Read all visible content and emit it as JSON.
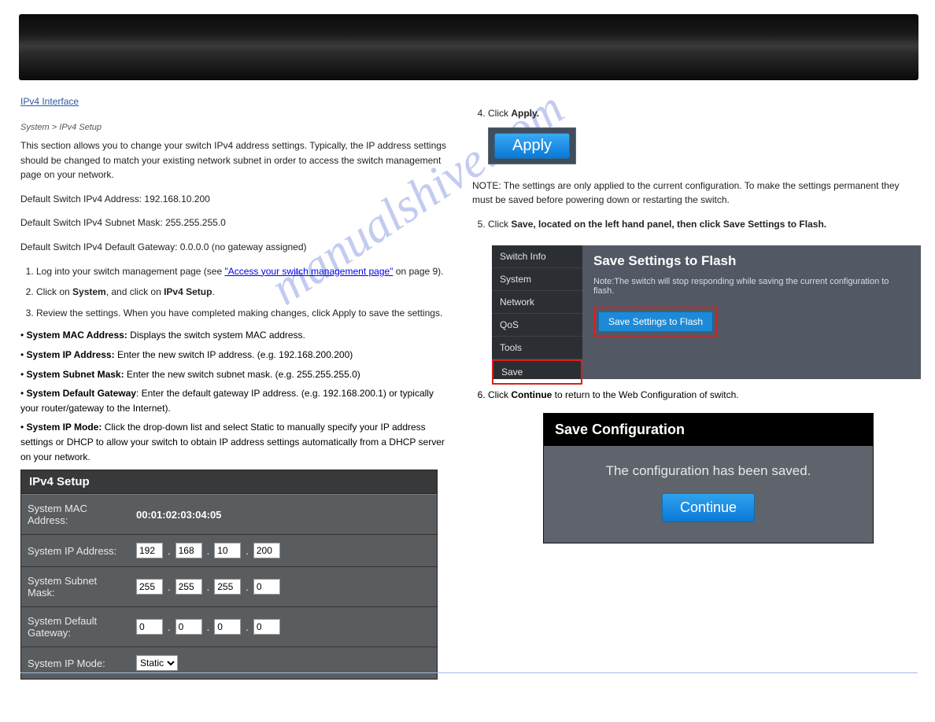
{
  "left": {
    "heading": "IPv4 Interface",
    "link": "System > IPv4 Setup",
    "para1_a": "This section allows you to change your switch IPv4 address settings. Typically, the IP address settings should be changed to match your existing network subnet in order to access the switch management page on your network.",
    "para2": "Default Switch IPv4 Address: 192.168.10.200",
    "para3": "Default Switch IPv4 Subnet Mask: 255.255.255.0",
    "para4": "Default Switch IPv4 Default Gateway: 0.0.0.0 (no gateway assigned)",
    "li1_a": "Log into your switch management page (see ",
    "li1_link": "\"Access your switch management page\"",
    "li1_b": " on page 9).",
    "li2_a": "Click on ",
    "li2_b": "System",
    "li2_c": ", and click on ",
    "li2_d": "IPv4 Setup",
    "li2_e": ".",
    "li3": "Review the settings. When you have completed making changes, click Apply to save the settings.",
    "bullets": {
      "mac_label": "System MAC Address:",
      "mac_text": " Displays the switch system MAC address.",
      "ip_label": "System IP Address:",
      "ip_text": " Enter the new switch IP address. (e.g. 192.168.200.200)",
      "subnet_label": "System Subnet Mask:",
      "subnet_text": " Enter the new switch subnet mask. (e.g. 255.255.255.0)",
      "gw_label": "System Default Gateway",
      "gw_text": ": Enter the default gateway IP address. (e.g. 192.168.200.1) or typically your router/gateway to the Internet).",
      "mode_label": "System IP Mode:",
      "mode_text": " Click the drop-down list and select Static to manually specify your IP address settings or DHCP to allow your switch to obtain IP address settings automatically from a DHCP server on your network."
    }
  },
  "ipv4_panel": {
    "title": "IPv4 Setup",
    "mac_label": "System MAC Address:",
    "mac_value": "00:01:02:03:04:05",
    "ip_label": "System IP Address:",
    "ip": [
      "192",
      "168",
      "10",
      "200"
    ],
    "subnet_label": "System Subnet Mask:",
    "subnet": [
      "255",
      "255",
      "255",
      "0"
    ],
    "gw_label": "System Default Gateway:",
    "gw": [
      "0",
      "0",
      "0",
      "0"
    ],
    "mode_label": "System IP Mode:",
    "mode_value": "Static"
  },
  "right": {
    "li4_a": "Click ",
    "li4_b": "Apply.",
    "apply_label": "Apply",
    "note_a": "NOTE: The settings are only applied to the current configuration. To make the settings permanent they must be saved before powering down or restarting the switch.",
    "li5_a": "Click ",
    "li5_b": "Save, located on the left hand panel, then click Save Settings to Flash.",
    "save_shot": {
      "nav": [
        "Switch Info",
        "System",
        "Network",
        "QoS",
        "Tools",
        "Save"
      ],
      "pane_title": "Save Settings to Flash",
      "pane_note": "Note:The switch will stop responding while saving the current configuration to flash.",
      "flash_btn": "Save Settings to Flash"
    },
    "li6_a": "Click ",
    "li6_b": "Continue",
    "li6_c": " to return to the Web Configuration of switch.",
    "save_conf": {
      "title": "Save Configuration",
      "msg": "The configuration has been saved.",
      "btn": "Continue"
    }
  },
  "watermark": "manualshive.com"
}
